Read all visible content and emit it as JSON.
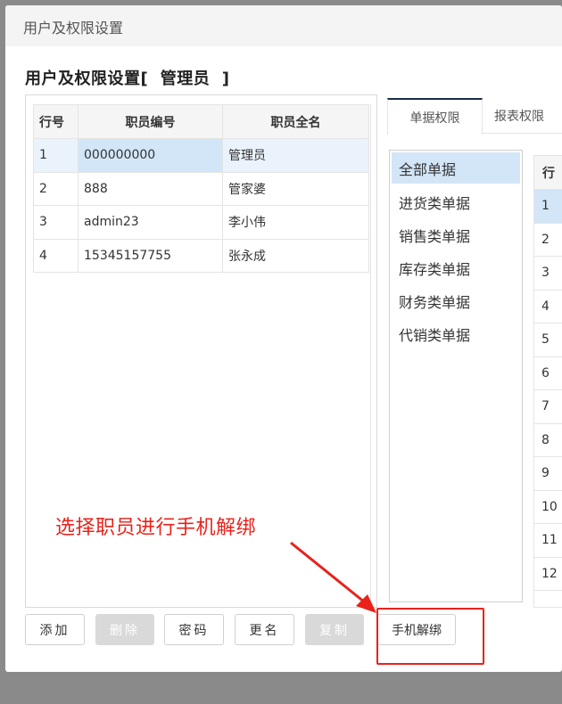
{
  "dialog": {
    "title": "用户及权限设置"
  },
  "page_title": "用户及权限设置[  管理员  ]",
  "user_table": {
    "headers": [
      "行号",
      "职员编号",
      "职员全名"
    ],
    "rows": [
      [
        "1",
        "000000000",
        "管理员"
      ],
      [
        "2",
        "888",
        "管家婆"
      ],
      [
        "3",
        "admin23",
        "李小伟"
      ],
      [
        "4",
        "15345157755",
        "张永成"
      ]
    ],
    "selected_row": 1
  },
  "tabs": [
    "单据权限",
    "报表权限"
  ],
  "doc_categories": [
    "全部单据",
    "进货类单据",
    "销售类单据",
    "库存类单据",
    "财务类单据",
    "代销类单据"
  ],
  "right_table": {
    "header": "行",
    "rows": [
      "1",
      "2",
      "3",
      "4",
      "5",
      "6",
      "7",
      "8",
      "9",
      "10",
      "11",
      "12"
    ]
  },
  "buttons": {
    "add": "添加",
    "delete": "删除",
    "password": "密码",
    "rename": "更名",
    "copy": "复制",
    "unbind_phone": "手机解绑"
  },
  "annotation": "选择职员进行手机解绑",
  "colors": {
    "accent_red": "#e8221b",
    "selection_blue": "#d3e6f8"
  }
}
